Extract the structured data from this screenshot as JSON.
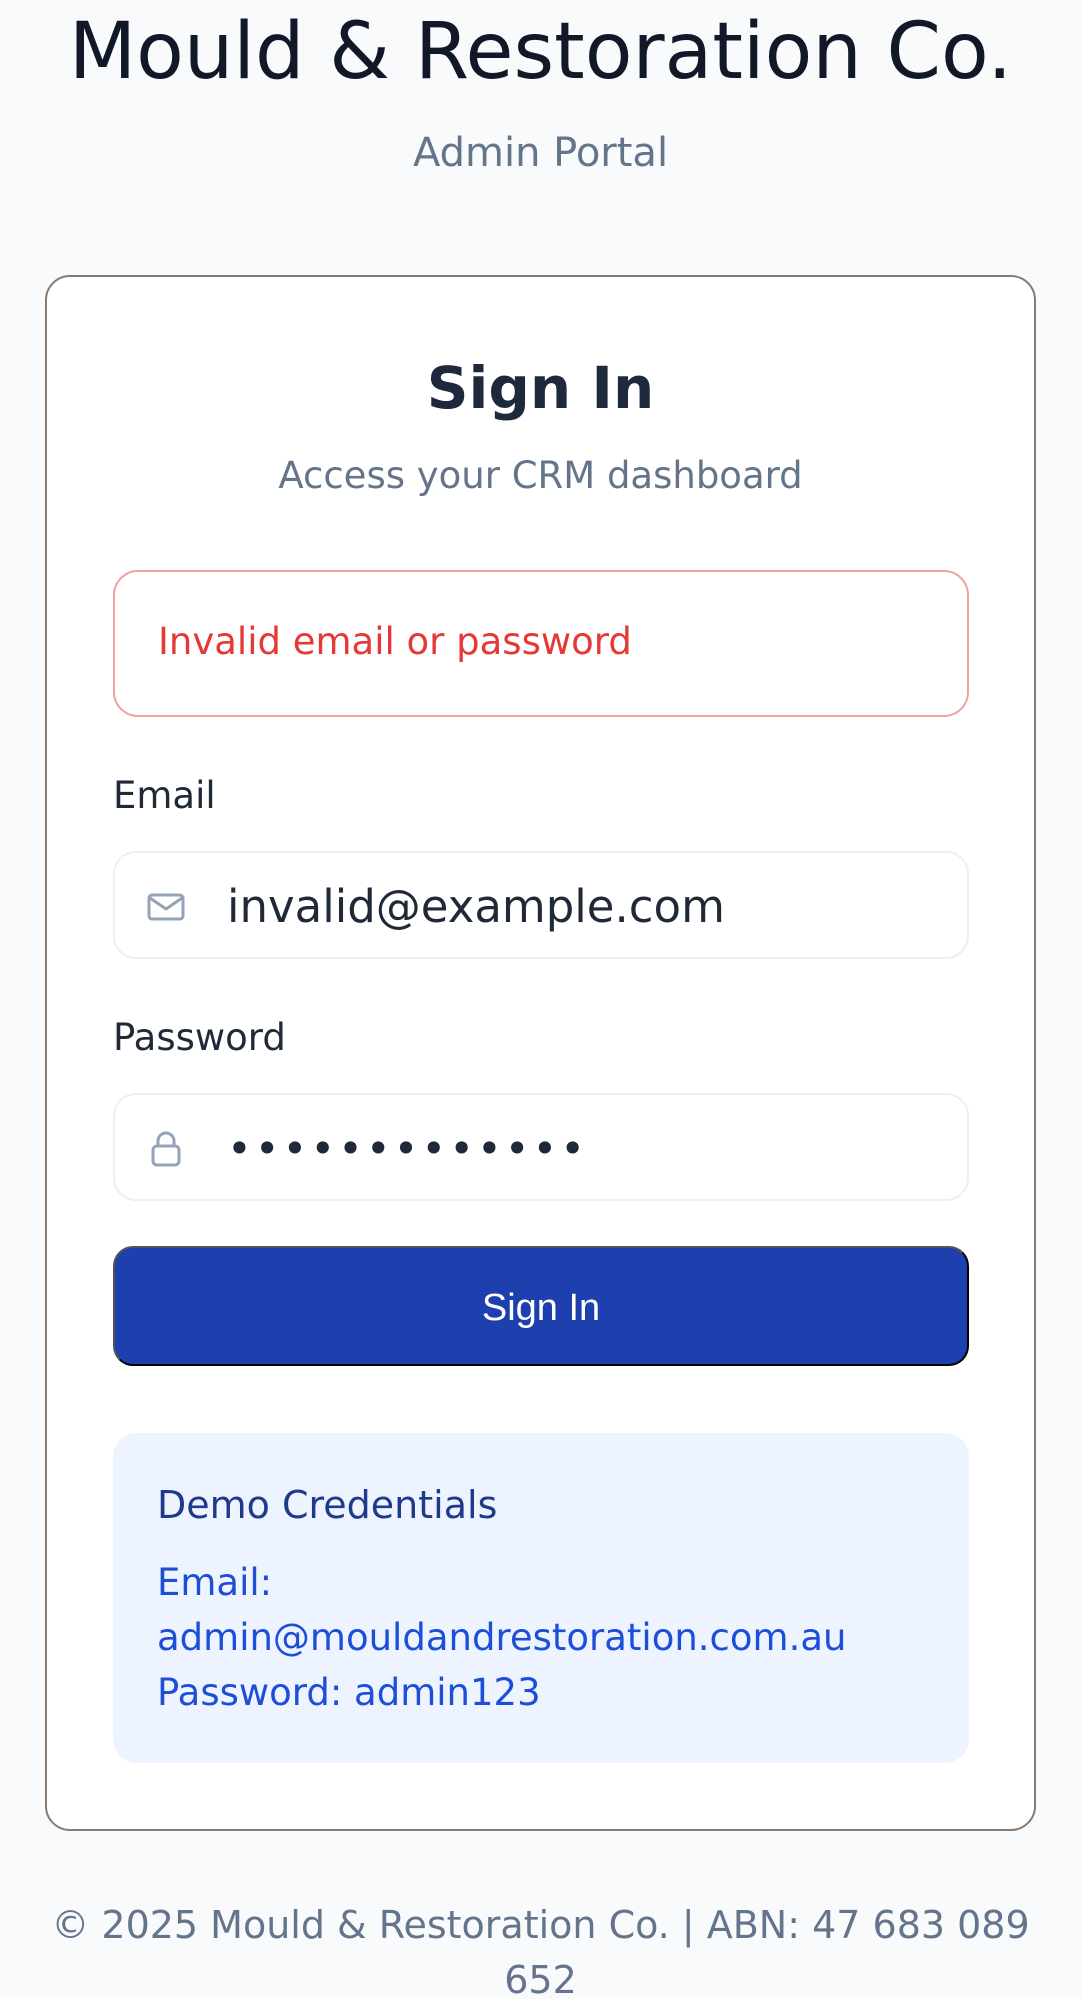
{
  "branding": {
    "title": "Mould & Restoration Co.",
    "subtitle": "Admin Portal"
  },
  "login": {
    "title": "Sign In",
    "subtitle": "Access your CRM dashboard",
    "error": "Invalid email or password",
    "email_label": "Email",
    "email_value": "invalid@example.com",
    "email_icon": "mail-icon",
    "password_label": "Password",
    "password_value": "•••••••••••••",
    "password_icon": "lock-icon",
    "submit_label": "Sign In"
  },
  "demo": {
    "title": "Demo Credentials",
    "email_label": "Email:",
    "email_value": "admin@mouldandrestoration.com.au",
    "password_line": "Password: admin123"
  },
  "footer": {
    "line1": "© 2025 Mould & Restoration Co. | ABN: 47 683 089",
    "line2": "652"
  },
  "colors": {
    "accent": "#1e40af",
    "error": "#e53935",
    "demo_background": "#eef4ff",
    "page_background": "#f8fafc"
  }
}
